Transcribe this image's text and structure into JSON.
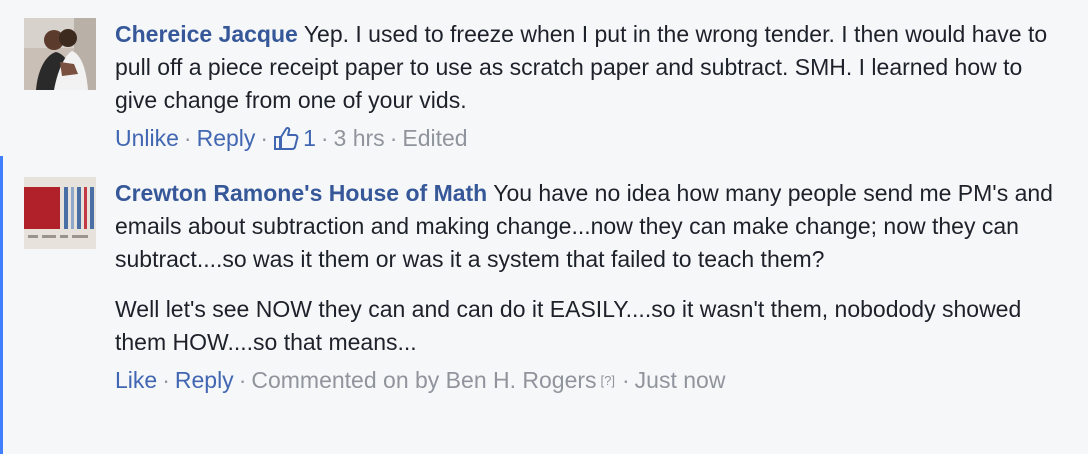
{
  "comments": [
    {
      "avatar_icon": "profile-photo",
      "author": "Chereice Jacque",
      "text": "Yep. I used to freeze when I put in the wrong tender. I then would have to pull off a piece receipt paper to use as scratch paper and subtract. SMH. I learned how to give change from one of your vids.",
      "actions": {
        "primary": "Unlike",
        "reply": "Reply",
        "like_icon": "thumbs-up-icon",
        "like_count": "1",
        "time": "3 hrs",
        "edited": "Edited"
      }
    },
    {
      "avatar_icon": "page-logo",
      "author": "Crewton Ramone's House of Math",
      "text": "You have no idea how many people send me PM's and emails about subtraction and making change...now they can make change; now they can subtract....so was it them or was it a system that failed to teach them?",
      "text2": "Well let's see NOW they can and can do it EASILY....so it wasn't them, nobodody showed them HOW....so that means...",
      "actions": {
        "primary": "Like",
        "reply": "Reply",
        "commented_on_by": "Commented on by Ben H. Rogers",
        "help_icon": "[?]",
        "time": "Just now"
      }
    }
  ],
  "colors": {
    "author": "#365899",
    "link": "#4267b2",
    "muted": "#90949c",
    "thread_bar": "#4080ff",
    "background": "#f6f7f9"
  }
}
